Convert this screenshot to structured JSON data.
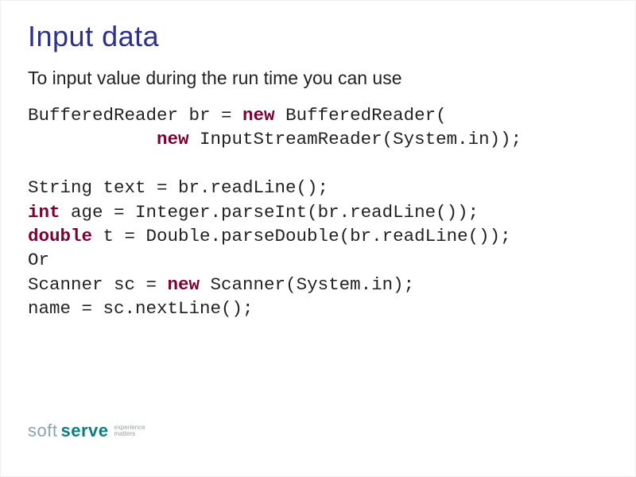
{
  "title": "Input data",
  "intro": "To input value during the run time you can use",
  "code": {
    "l1a": "BufferedReader br = ",
    "l1_kw": "new",
    "l1b": " BufferedReader(",
    "l2_indent": "            ",
    "l2_kw": "new",
    "l2b": " InputStreamReader(System.in));",
    "blank": "",
    "l4": "String text = br.readLine();",
    "l5_kw": "int",
    "l5b": " age = Integer.parseInt(br.readLine());",
    "l6_kw": "double",
    "l6b": " t = Double.parseDouble(br.readLine());",
    "l7": "Or",
    "l8a": "Scanner sc = ",
    "l8_kw": "new",
    "l8b": " Scanner(System.in);",
    "l9": "name = sc.nextLine();"
  },
  "logo": {
    "soft": "soft",
    "serve": "serve",
    "tag1": "experience",
    "tag2": "matters"
  }
}
